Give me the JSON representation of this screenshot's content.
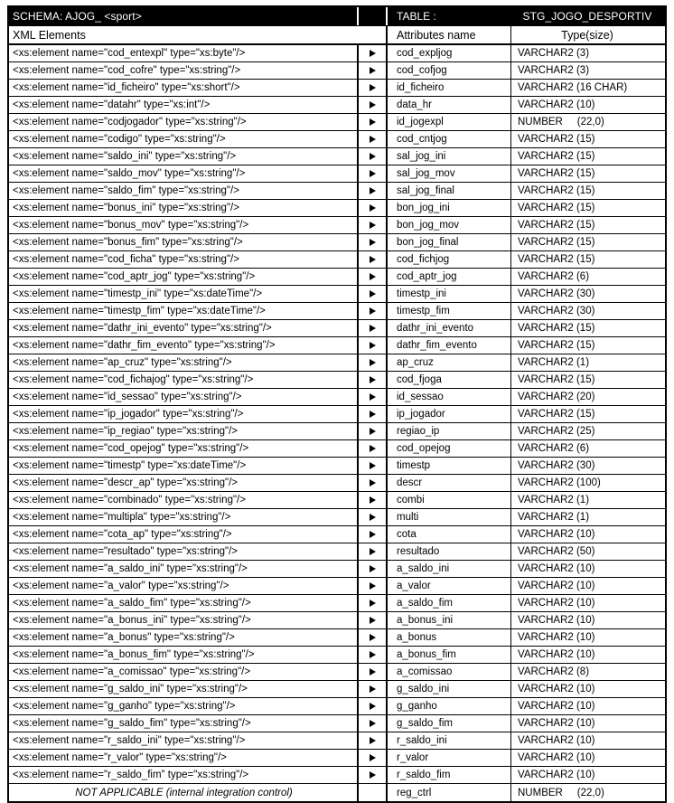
{
  "banner": {
    "schema": "SCHEMA: AJOG_ <sport>",
    "table_label": "TABLE :",
    "table_name": "STG_JOGO_DESPORTIV"
  },
  "columns": {
    "xml": "XML Elements",
    "attributes": "Attributes name",
    "type": "Type(size)"
  },
  "icons": {
    "mapping_arrow": "triangle-right-icon"
  },
  "note_row": {
    "xml": "NOT APPLICABLE (internal integration control)",
    "attribute": "reg_ctrl",
    "type": "NUMBER     (22,0)"
  },
  "rows": [
    {
      "xml": "<xs:element name=\"cod_entexpl\" type=\"xs:byte\"/>",
      "attribute": "cod_expljog",
      "type": "VARCHAR2 (3)"
    },
    {
      "xml": "<xs:element name=\"cod_cofre\" type=\"xs:string\"/>",
      "attribute": "cod_cofjog",
      "type": "VARCHAR2 (3)"
    },
    {
      "xml": "<xs:element name=\"id_ficheiro\" type=\"xs:short\"/>",
      "attribute": "id_ficheiro",
      "type": "VARCHAR2 (16 CHAR)"
    },
    {
      "xml": "<xs:element name=\"datahr\" type=\"xs:int\"/>",
      "attribute": "data_hr",
      "type": "VARCHAR2 (10)"
    },
    {
      "xml": "<xs:element name=\"codjogador\" type=\"xs:string\"/>",
      "attribute": "id_jogexpl",
      "type": "NUMBER     (22,0)"
    },
    {
      "xml": "<xs:element name=\"codigo\" type=\"xs:string\"/>",
      "attribute": "cod_cntjog",
      "type": "VARCHAR2 (15)"
    },
    {
      "xml": "<xs:element name=\"saldo_ini\" type=\"xs:string\"/>",
      "attribute": "sal_jog_ini",
      "type": "VARCHAR2 (15)"
    },
    {
      "xml": "<xs:element name=\"saldo_mov\" type=\"xs:string\"/>",
      "attribute": "sal_jog_mov",
      "type": "VARCHAR2 (15)"
    },
    {
      "xml": "<xs:element name=\"saldo_fim\" type=\"xs:string\"/>",
      "attribute": "sal_jog_final",
      "type": "VARCHAR2 (15)"
    },
    {
      "xml": "<xs:element name=\"bonus_ini\" type=\"xs:string\"/>",
      "attribute": "bon_jog_ini",
      "type": "VARCHAR2 (15)"
    },
    {
      "xml": "<xs:element name=\"bonus_mov\" type=\"xs:string\"/>",
      "attribute": "bon_jog_mov",
      "type": "VARCHAR2 (15)"
    },
    {
      "xml": "<xs:element name=\"bonus_fim\" type=\"xs:string\"/>",
      "attribute": "bon_jog_final",
      "type": "VARCHAR2 (15)"
    },
    {
      "xml": "<xs:element name=\"cod_ficha\" type=\"xs:string\"/>",
      "attribute": "cod_fichjog",
      "type": "VARCHAR2 (15)"
    },
    {
      "xml": "<xs:element name=\"cod_aptr_jog\" type=\"xs:string\"/>",
      "attribute": "cod_aptr_jog",
      "type": "VARCHAR2 (6)"
    },
    {
      "xml": "<xs:element name=\"timestp_ini\" type=\"xs:dateTime\"/>",
      "attribute": "timestp_ini",
      "type": "VARCHAR2 (30)"
    },
    {
      "xml": "<xs:element name=\"timestp_fim\" type=\"xs:dateTime\"/>",
      "attribute": "timestp_fim",
      "type": "VARCHAR2 (30)"
    },
    {
      "xml": "<xs:element name=\"dathr_ini_evento\" type=\"xs:string\"/>",
      "attribute": "dathr_ini_evento",
      "type": "VARCHAR2 (15)"
    },
    {
      "xml": "<xs:element name=\"dathr_fim_evento\" type=\"xs:string\"/>",
      "attribute": "dathr_fim_evento",
      "type": "VARCHAR2 (15)"
    },
    {
      "xml": "<xs:element name=\"ap_cruz\" type=\"xs:string\"/>",
      "attribute": "ap_cruz",
      "type": "VARCHAR2 (1)"
    },
    {
      "xml": "<xs:element name=\"cod_fichajog\" type=\"xs:string\"/>",
      "attribute": "cod_fjoga",
      "type": "VARCHAR2 (15)"
    },
    {
      "xml": "<xs:element name=\"id_sessao\" type=\"xs:string\"/>",
      "attribute": "id_sessao",
      "type": "VARCHAR2 (20)"
    },
    {
      "xml": "<xs:element name=\"ip_jogador\" type=\"xs:string\"/>",
      "attribute": "ip_jogador",
      "type": "VARCHAR2 (15)"
    },
    {
      "xml": "<xs:element name=\"ip_regiao\" type=\"xs:string\"/>",
      "attribute": "regiao_ip",
      "type": "VARCHAR2 (25)"
    },
    {
      "xml": "<xs:element name=\"cod_opejog\" type=\"xs:string\"/>",
      "attribute": "cod_opejog",
      "type": "VARCHAR2 (6)"
    },
    {
      "xml": "<xs:element name=\"timestp\" type=\"xs:dateTime\"/>",
      "attribute": "timestp",
      "type": "VARCHAR2 (30)"
    },
    {
      "xml": "<xs:element name=\"descr_ap\" type=\"xs:string\"/>",
      "attribute": "descr",
      "type": "VARCHAR2 (100)"
    },
    {
      "xml": "<xs:element name=\"combinado\" type=\"xs:string\"/>",
      "attribute": "combi",
      "type": "VARCHAR2 (1)"
    },
    {
      "xml": "<xs:element name=\"multipla\" type=\"xs:string\"/>",
      "attribute": "multi",
      "type": "VARCHAR2 (1)"
    },
    {
      "xml": "<xs:element name=\"cota_ap\" type=\"xs:string\"/>",
      "attribute": "cota",
      "type": "VARCHAR2 (10)"
    },
    {
      "xml": "<xs:element name=\"resultado\" type=\"xs:string\"/>",
      "attribute": "resultado",
      "type": "VARCHAR2 (50)"
    },
    {
      "xml": "<xs:element name=\"a_saldo_ini\" type=\"xs:string\"/>",
      "attribute": "a_saldo_ini",
      "type": "VARCHAR2 (10)"
    },
    {
      "xml": "<xs:element name=\"a_valor\" type=\"xs:string\"/>",
      "attribute": "a_valor",
      "type": "VARCHAR2 (10)"
    },
    {
      "xml": "<xs:element name=\"a_saldo_fim\" type=\"xs:string\"/>",
      "attribute": "a_saldo_fim",
      "type": "VARCHAR2 (10)"
    },
    {
      "xml": "<xs:element name=\"a_bonus_ini\" type=\"xs:string\"/>",
      "attribute": "a_bonus_ini",
      "type": "VARCHAR2 (10)"
    },
    {
      "xml": "<xs:element name=\"a_bonus\" type=\"xs:string\"/>",
      "attribute": "a_bonus",
      "type": "VARCHAR2 (10)"
    },
    {
      "xml": "<xs:element name=\"a_bonus_fim\" type=\"xs:string\"/>",
      "attribute": "a_bonus_fim",
      "type": "VARCHAR2 (10)"
    },
    {
      "xml": "<xs:element name=\"a_comissao\" type=\"xs:string\"/>",
      "attribute": "a_comissao",
      "type": "VARCHAR2 (8)"
    },
    {
      "xml": "<xs:element name=\"g_saldo_ini\" type=\"xs:string\"/>",
      "attribute": "g_saldo_ini",
      "type": "VARCHAR2 (10)"
    },
    {
      "xml": "<xs:element name=\"g_ganho\" type=\"xs:string\"/>",
      "attribute": "g_ganho",
      "type": "VARCHAR2 (10)"
    },
    {
      "xml": "<xs:element name=\"g_saldo_fim\" type=\"xs:string\"/>",
      "attribute": "g_saldo_fim",
      "type": "VARCHAR2 (10)"
    },
    {
      "xml": "<xs:element name=\"r_saldo_ini\" type=\"xs:string\"/>",
      "attribute": "r_saldo_ini",
      "type": "VARCHAR2 (10)"
    },
    {
      "xml": "<xs:element name=\"r_valor\" type=\"xs:string\"/>",
      "attribute": "r_valor",
      "type": "VARCHAR2 (10)"
    },
    {
      "xml": "<xs:element name=\"r_saldo_fim\" type=\"xs:string\"/>",
      "attribute": "r_saldo_fim",
      "type": "VARCHAR2 (10)"
    }
  ]
}
